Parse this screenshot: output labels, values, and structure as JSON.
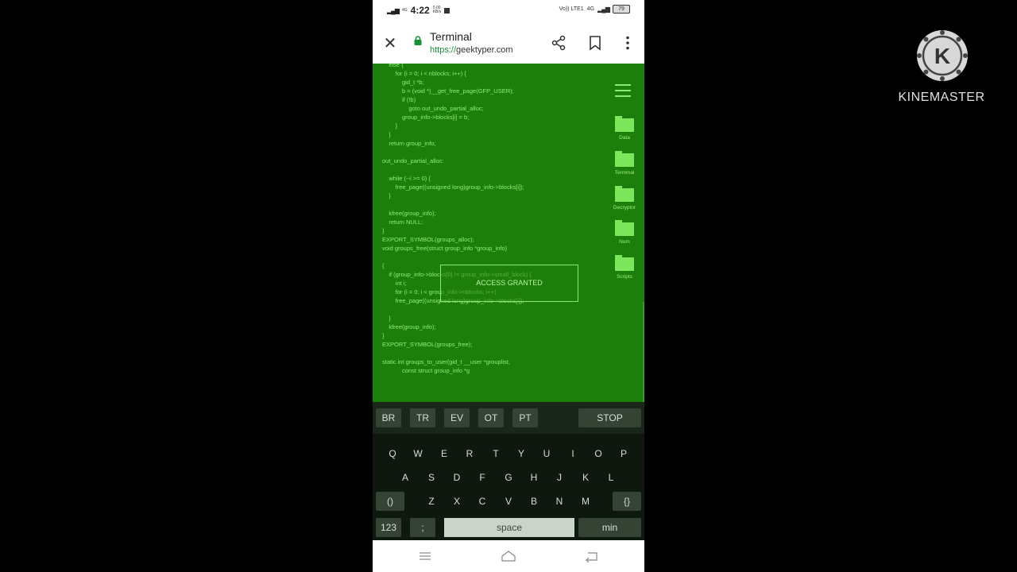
{
  "status_bar": {
    "time": "4:22",
    "speed_value": "0.00",
    "speed_unit": "KB/s",
    "net_left": "4G",
    "carrier_right": "Vo)) LTE1",
    "net_right": "4G",
    "battery": "79"
  },
  "browser": {
    "title": "Terminal",
    "url_protocol": "https://",
    "url_domain": "geektyper.com"
  },
  "terminal": {
    "code": "    else {\n        for (i = 0; i < nblocks; i++) {\n            gid_t *b;\n            b = (void *)__get_free_page(GFP_USER);\n            if (!b)\n                goto out_undo_partial_alloc;\n            group_info->blocks[i] = b;\n        }\n    }\n    return group_info;\n\nout_undo_partial_alloc:\n\n    while (--i >= 0) {\n        free_page((unsigned long)group_info->blocks[i]);\n    }\n\n    kfree(group_info);\n    return NULL;\n}\nEXPORT_SYMBOL(groups_alloc);\nvoid groups_free(struct group_info *group_info)\n\n{\n    if (group_info->blocks[0] != group_info->small_block) {\n        int i;\n        for (i = 0; i < group_info->nblocks; i++)\n        free_page((unsigned long)group_info->blocks[i]);\n\n    }\n    kfree(group_info);\n}\nEXPORT_SYMBOL(groups_free);\n\nstatic int groups_to_user(gid_t __user *grouplist,\n            const struct group_info *g",
    "access_text": "ACCESS GRANTED",
    "folders": [
      "Data",
      "Terminal",
      "Decryptor",
      "Num",
      "Scripts"
    ]
  },
  "keyboard": {
    "top_row": [
      "BR",
      "TR",
      "EV",
      "OT",
      "PT"
    ],
    "stop": "STOP",
    "row1": [
      "Q",
      "W",
      "E",
      "R",
      "T",
      "Y",
      "U",
      "I",
      "O",
      "P"
    ],
    "row2": [
      "A",
      "S",
      "D",
      "F",
      "G",
      "H",
      "J",
      "K",
      "L"
    ],
    "row3_left": "()",
    "row3": [
      "Z",
      "X",
      "C",
      "V",
      "B",
      "N",
      "M"
    ],
    "row3_right": "{}",
    "num_key": "123",
    "semicolon": ";",
    "space": "space",
    "min": "min"
  },
  "watermark": {
    "logo_letter": "K",
    "name": "KINEMASTER"
  }
}
